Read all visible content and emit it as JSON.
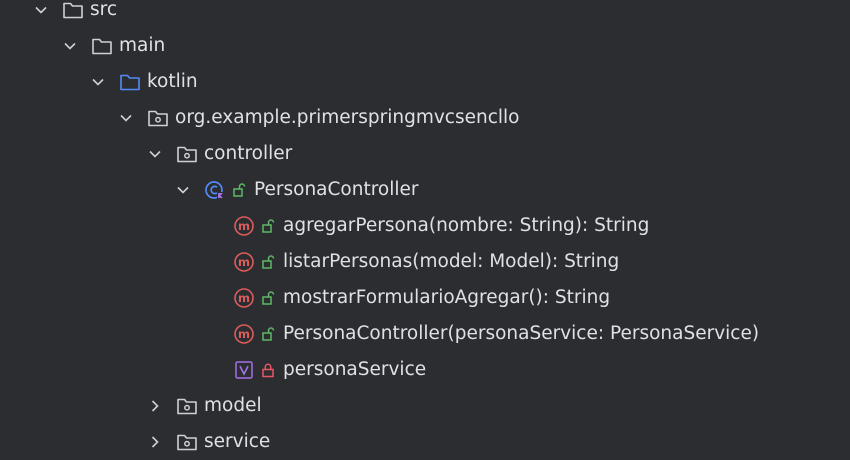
{
  "tree": {
    "src": "src",
    "main": "main",
    "kotlin": "kotlin",
    "package": "org.example.primerspringmvcsencllo",
    "controller": "controller",
    "persona_controller": "PersonaController",
    "members": [
      "agregarPersona(nombre: String): String",
      "listarPersonas(model: Model): String",
      "mostrarFormularioAgregar(): String",
      "PersonaController(personaService: PersonaService)",
      "personaService"
    ],
    "model": "model",
    "service": "service"
  },
  "colors": {
    "background": "#2b2d30",
    "text": "#dfe1e5",
    "chevron": "#ced0d6",
    "folder_gray": "#ced0d6",
    "folder_blue": "#548af7",
    "method_red": "#db5c5c",
    "public_green": "#5fb865",
    "field_purple": "#a571e6",
    "private_red": "#e55765"
  }
}
